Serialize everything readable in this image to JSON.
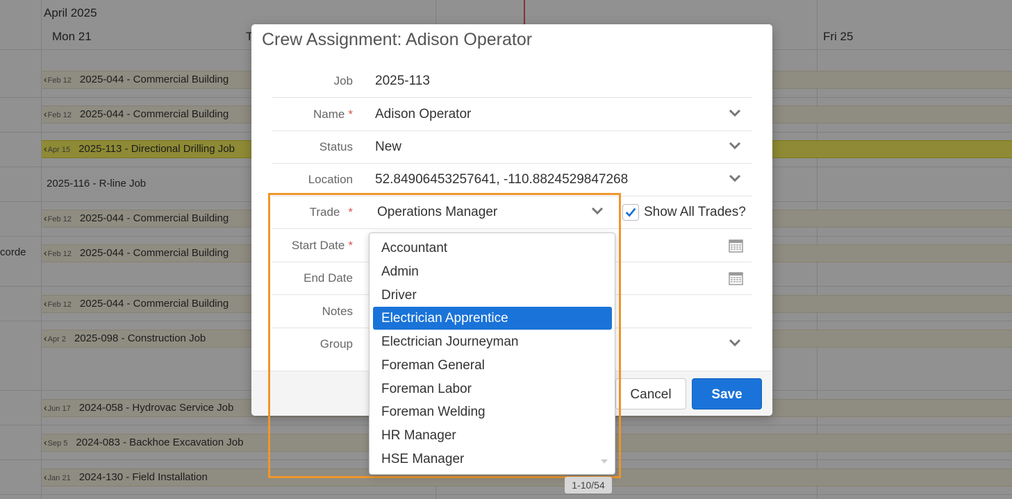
{
  "calendar": {
    "month": "April 2025",
    "days": [
      {
        "label": "Mon 21"
      },
      {
        "label": "T"
      },
      {
        "label": "Fri 25"
      }
    ],
    "rows": [
      {
        "badge": "Feb 12",
        "text": "2025-044 - Commercial Building"
      },
      {
        "badge": "Feb 12",
        "text": "2025-044 - Commercial Building"
      },
      {
        "badge": "Apr 15",
        "text": "2025-113 - Directional Drilling Job"
      },
      {
        "badge": "",
        "text": "2025-116 - R-line Job"
      },
      {
        "badge": "Feb 12",
        "text": "2025-044 - Commercial Building"
      },
      {
        "badge": "Feb 12",
        "text": "2025-044 - Commercial Building"
      },
      {
        "badge": "Feb 12",
        "text": "2025-044 - Commercial Building"
      },
      {
        "badge": "Apr 2",
        "text": "2025-098 - Construction Job"
      },
      {
        "badge": "Jun 17",
        "text": "2024-058 - Hydrovac Service Job"
      },
      {
        "badge": "Sep 5",
        "text": "2024-083 - Backhoe Excavation Job"
      },
      {
        "badge": "Jan 21",
        "text": "2024-130 - Field Installation"
      }
    ],
    "left_partial": "corde"
  },
  "modal": {
    "title": "Crew Assignment: Adison Operator",
    "fields": {
      "job": {
        "label": "Job",
        "value": "2025-113"
      },
      "name": {
        "label": "Name",
        "required": "*",
        "value": "Adison Operator"
      },
      "status": {
        "label": "Status",
        "value": "New"
      },
      "location": {
        "label": "Location",
        "value": "52.84906453257641, -110.8824529847268"
      },
      "trade": {
        "label": "Trade",
        "required": "*",
        "value": "Operations Manager"
      },
      "start_date": {
        "label": "Start Date",
        "required": "*"
      },
      "end_date": {
        "label": "End Date"
      },
      "notes": {
        "label": "Notes"
      },
      "group": {
        "label": "Group"
      }
    },
    "show_all_trades": {
      "label": "Show All Trades?",
      "checked": true
    },
    "buttons": {
      "cancel": "Cancel",
      "save": "Save"
    }
  },
  "trade_dropdown": {
    "options": [
      "Accountant",
      "Admin",
      "Driver",
      "Electrician Apprentice",
      "Electrician Journeyman",
      "Foreman General",
      "Foreman Labor",
      "Foreman Welding",
      "HR Manager",
      "HSE Manager"
    ],
    "highlighted": "Electrician Apprentice",
    "pager": "1-10/54"
  },
  "colors": {
    "accent": "#1a73d8",
    "highlight_border": "#f0962a",
    "required": "#d9534f",
    "today_line": "#e05c5c"
  },
  "icons": [
    "chevron-down-icon",
    "calendar-icon",
    "checkmark-icon",
    "chevron-left-icon",
    "scroll-down-icon"
  ]
}
